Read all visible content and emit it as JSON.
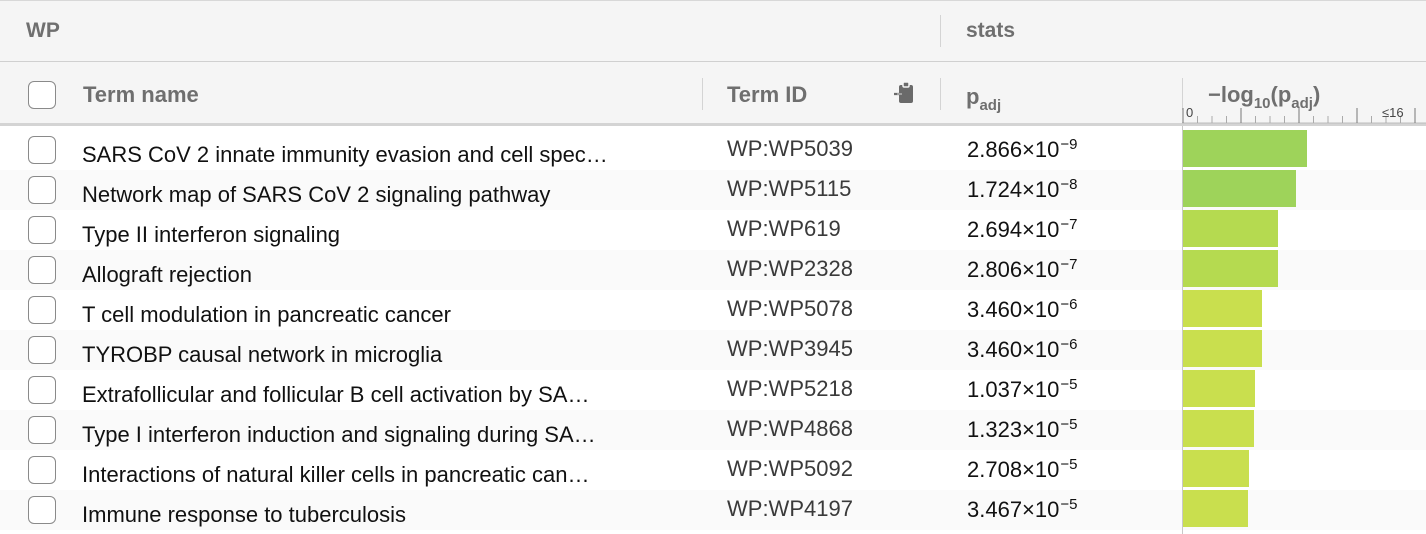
{
  "group_header": {
    "source": "WP",
    "stats": "stats"
  },
  "columns": {
    "term_name": "Term name",
    "term_id": "Term ID",
    "padj_base": "p",
    "padj_sub": "adj",
    "log_prefix": "−log",
    "log_base_sub": "10",
    "log_open": "(p",
    "log_inner_sub": "adj",
    "log_close": ")",
    "axis_min": "0",
    "axis_max": "≤16"
  },
  "colors": {
    "bar_high": "#9ed35a",
    "bar_mid": "#b5da50",
    "bar_low": "#c9df4e"
  },
  "rows": [
    {
      "name": "SARS CoV 2 innate immunity evasion and cell spec…",
      "id": "WP:WP5039",
      "p_mant": "2.866×10",
      "p_exp": "−9",
      "neglog": 8.54
    },
    {
      "name": "Network map of SARS CoV 2 signaling pathway",
      "id": "WP:WP5115",
      "p_mant": "1.724×10",
      "p_exp": "−8",
      "neglog": 7.76
    },
    {
      "name": "Type II interferon signaling",
      "id": "WP:WP619",
      "p_mant": "2.694×10",
      "p_exp": "−7",
      "neglog": 6.57
    },
    {
      "name": "Allograft rejection",
      "id": "WP:WP2328",
      "p_mant": "2.806×10",
      "p_exp": "−7",
      "neglog": 6.55
    },
    {
      "name": "T cell modulation in pancreatic cancer",
      "id": "WP:WP5078",
      "p_mant": "3.460×10",
      "p_exp": "−6",
      "neglog": 5.46
    },
    {
      "name": "TYROBP causal network in microglia",
      "id": "WP:WP3945",
      "p_mant": "3.460×10",
      "p_exp": "−6",
      "neglog": 5.46
    },
    {
      "name": "Extrafollicular and follicular B cell activation by SA…",
      "id": "WP:WP5218",
      "p_mant": "1.037×10",
      "p_exp": "−5",
      "neglog": 4.98
    },
    {
      "name": "Type I interferon induction and signaling during SA…",
      "id": "WP:WP4868",
      "p_mant": "1.323×10",
      "p_exp": "−5",
      "neglog": 4.88
    },
    {
      "name": "Interactions of natural killer cells in pancreatic can…",
      "id": "WP:WP5092",
      "p_mant": "2.708×10",
      "p_exp": "−5",
      "neglog": 4.57
    },
    {
      "name": "Immune response to tuberculosis",
      "id": "WP:WP4197",
      "p_mant": "3.467×10",
      "p_exp": "−5",
      "neglog": 4.46
    }
  ]
}
